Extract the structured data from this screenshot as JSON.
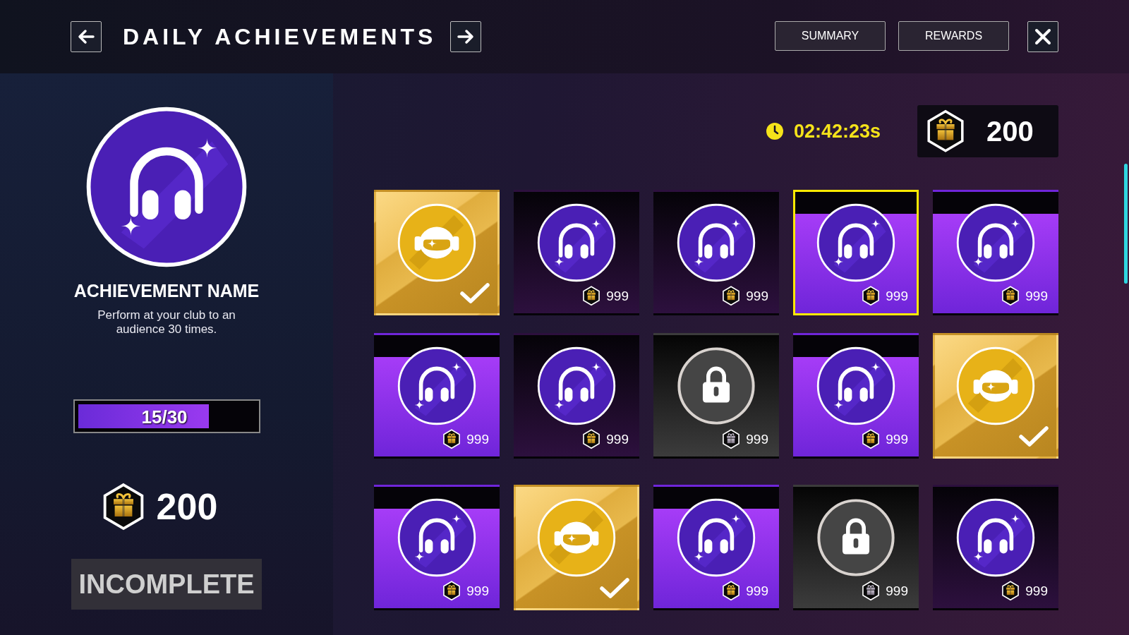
{
  "header": {
    "title": "DAILY ACHIEVEMENTS",
    "buttons": [
      {
        "label": "SUMMARY"
      },
      {
        "label": "REWARDS"
      }
    ]
  },
  "detail": {
    "name": "ACHIEVEMENT NAME",
    "description": "Perform at your club to an audience 30 times.",
    "progress": {
      "label": "15/30",
      "level": 0.74
    },
    "reward": "200",
    "status": "INCOMPLETE"
  },
  "timer": "02:42:23s",
  "balance": "200",
  "rows": [
    {
      "tiles": [
        {
          "kind": "complete",
          "selected": false
        },
        {
          "kind": "pending",
          "selected": false,
          "reward": "999"
        },
        {
          "kind": "pending",
          "selected": false,
          "reward": "999"
        },
        {
          "kind": "active",
          "selected": true,
          "reward": "999"
        },
        {
          "kind": "active",
          "selected": false,
          "reward": "999"
        }
      ]
    },
    {
      "tiles": [
        {
          "kind": "active",
          "selected": false,
          "reward": "999"
        },
        {
          "kind": "pending",
          "selected": false,
          "reward": "999"
        },
        {
          "kind": "locked",
          "selected": false,
          "reward": "999"
        },
        {
          "kind": "active",
          "selected": false,
          "reward": "999"
        },
        {
          "kind": "complete",
          "selected": false
        }
      ]
    },
    {
      "tiles": [
        {
          "kind": "active",
          "selected": false,
          "reward": "999"
        },
        {
          "kind": "complete",
          "selected": false
        },
        {
          "kind": "active",
          "selected": false,
          "reward": "999"
        },
        {
          "kind": "locked",
          "selected": false,
          "reward": "999"
        },
        {
          "kind": "pending",
          "selected": false,
          "reward": "999"
        }
      ]
    }
  ]
}
